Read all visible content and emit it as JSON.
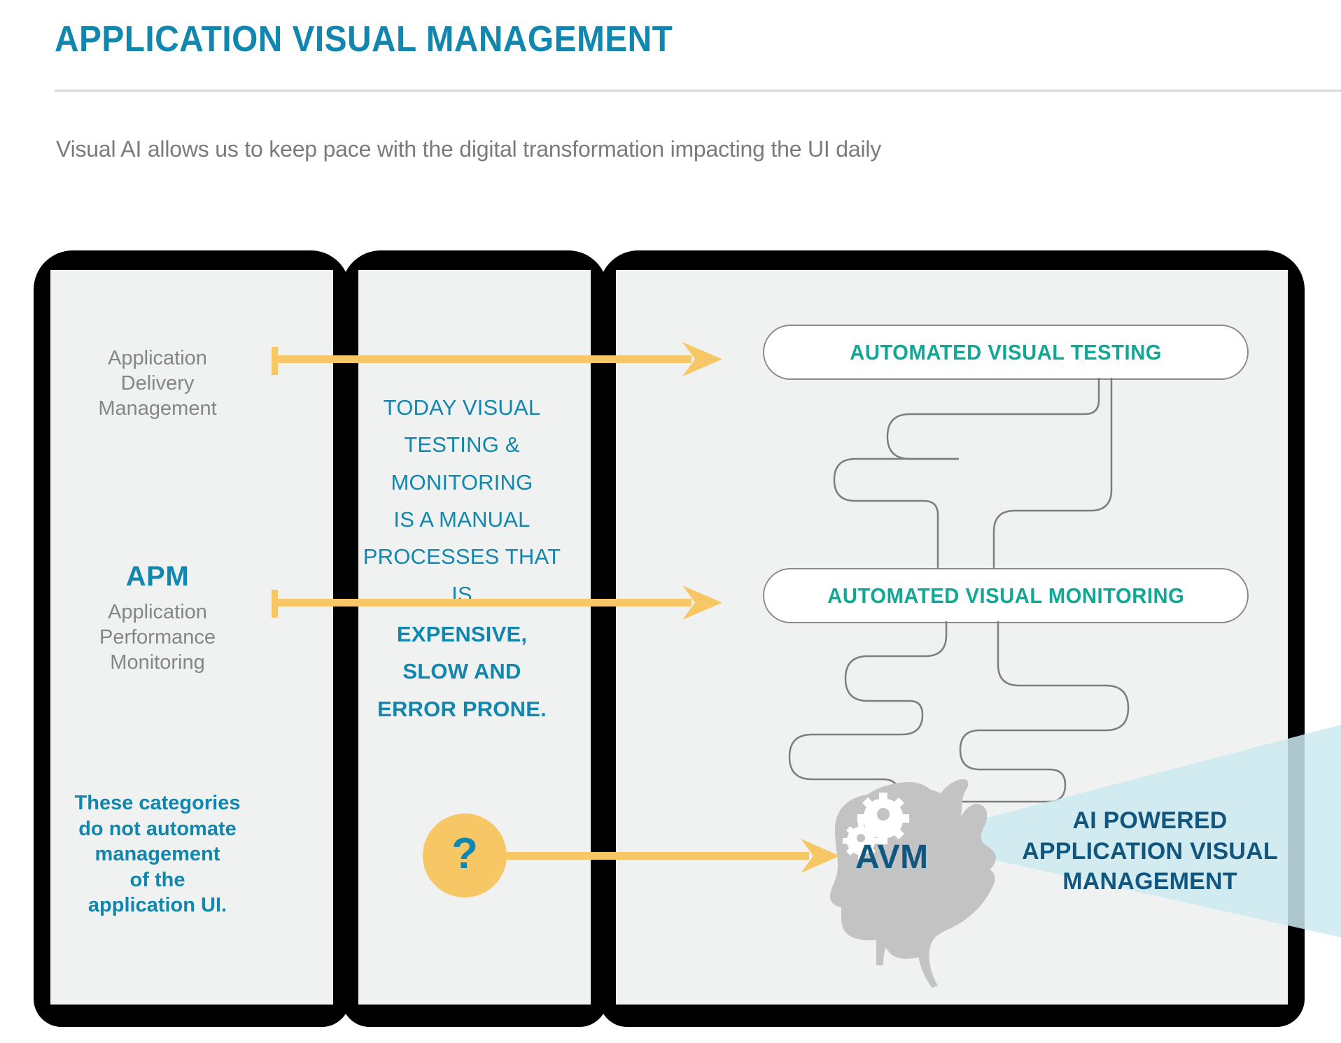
{
  "header": {
    "title": "APPLICATION VISUAL MANAGEMENT",
    "subtitle": "Visual AI allows us to keep pace with the digital transformation impacting the UI daily"
  },
  "colors": {
    "title_blue": "#1187B0",
    "subtitle_gray": "#7B7B7B",
    "muted_gray": "#868686",
    "pill_teal": "#0FA795",
    "navy": "#10567F",
    "arrow_gold": "#F8C765",
    "panel_bg": "#F0F2F1",
    "frame_black": "#000000",
    "beam_cyan": "#C9EBF0",
    "head_gray": "#C0C0C0"
  },
  "columns": {
    "left": {
      "adm": {
        "acronym": "",
        "line1": "Application",
        "line2": "Delivery",
        "line3": "Management"
      },
      "apm": {
        "acronym": "APM",
        "line1": "Application",
        "line2": "Performance",
        "line3": "Monitoring"
      },
      "note": {
        "line1": "These categories",
        "line2": "do not automate",
        "line3": "management",
        "line4": "of the",
        "line5": "application UI."
      }
    },
    "middle": {
      "regular": {
        "line1": "TODAY VISUAL",
        "line2": "TESTING &",
        "line3": "MONITORING",
        "line4": "IS A MANUAL",
        "line5": "PROCESSES THAT IS"
      },
      "bold": {
        "line1": "EXPENSIVE,",
        "line2": "SLOW AND",
        "line3": "ERROR PRONE."
      },
      "question_mark": "?"
    },
    "right": {
      "pills": [
        {
          "label": "AUTOMATED VISUAL TESTING"
        },
        {
          "label": "AUTOMATED VISUAL MONITORING"
        }
      ],
      "brain": {
        "label": "AVM"
      },
      "beam_text": {
        "line1": "AI POWERED",
        "line2": "APPLICATION VISUAL",
        "line3": "MANAGEMENT"
      }
    }
  },
  "arrows": [
    {
      "name": "arrow-adm-to-testing"
    },
    {
      "name": "arrow-apm-to-monitoring"
    },
    {
      "name": "arrow-question-to-avm"
    }
  ]
}
